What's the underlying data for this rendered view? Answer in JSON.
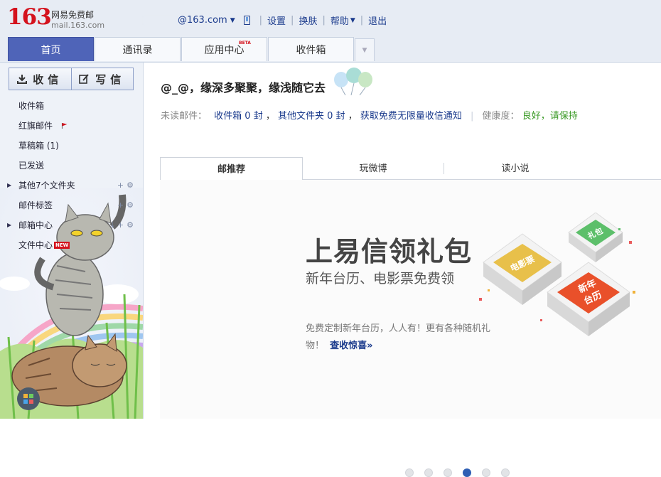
{
  "header": {
    "logo_number": "163",
    "logo_cn": "网易免费邮",
    "logo_url": "mail.163.com",
    "user": "@163.com",
    "links": [
      "设置",
      "换肤",
      "帮助",
      "退出"
    ]
  },
  "nav_tabs": [
    {
      "label": "首页",
      "active": true
    },
    {
      "label": "通讯录"
    },
    {
      "label": "应用中心",
      "badge": "BETA"
    },
    {
      "label": "收件箱"
    }
  ],
  "sidebar": {
    "receive_label": "收信",
    "write_label": "写信",
    "folders": [
      {
        "label": "收件箱"
      },
      {
        "label": "红旗邮件"
      },
      {
        "label": "草稿箱 (1)"
      },
      {
        "label": "已发送"
      },
      {
        "label": "其他7个文件夹"
      },
      {
        "label": "邮件标签"
      },
      {
        "label": "邮箱中心"
      },
      {
        "label": "文件中心"
      }
    ],
    "new_badge": "NEW",
    "accent": "#4f64b8"
  },
  "main": {
    "greeting": "@_@，缘深多聚聚，缘浅随它去",
    "stats": {
      "unread_label": "未读邮件：",
      "inbox": "收件箱 0 封",
      "comma1": "，",
      "other": "其他文件夹 0 封",
      "comma2": "，",
      "notify": "获取免费无限量收信通知",
      "health_label": "健康度：",
      "health_value": "良好，请保持"
    },
    "rec_tabs": [
      "邮推荐",
      "玩微博",
      "读小说"
    ],
    "promo": {
      "title": "上易信领礼包",
      "subtitle": "新年台历、电影票免费领",
      "desc": "免费定制新年台历，人人有！更有各种随机礼物！",
      "link": "查收惊喜»",
      "box1": "电影票",
      "box2": "礼包",
      "box3a": "新年",
      "box3b": "台历"
    },
    "carousel": {
      "count": 6,
      "active_index": 3
    }
  }
}
